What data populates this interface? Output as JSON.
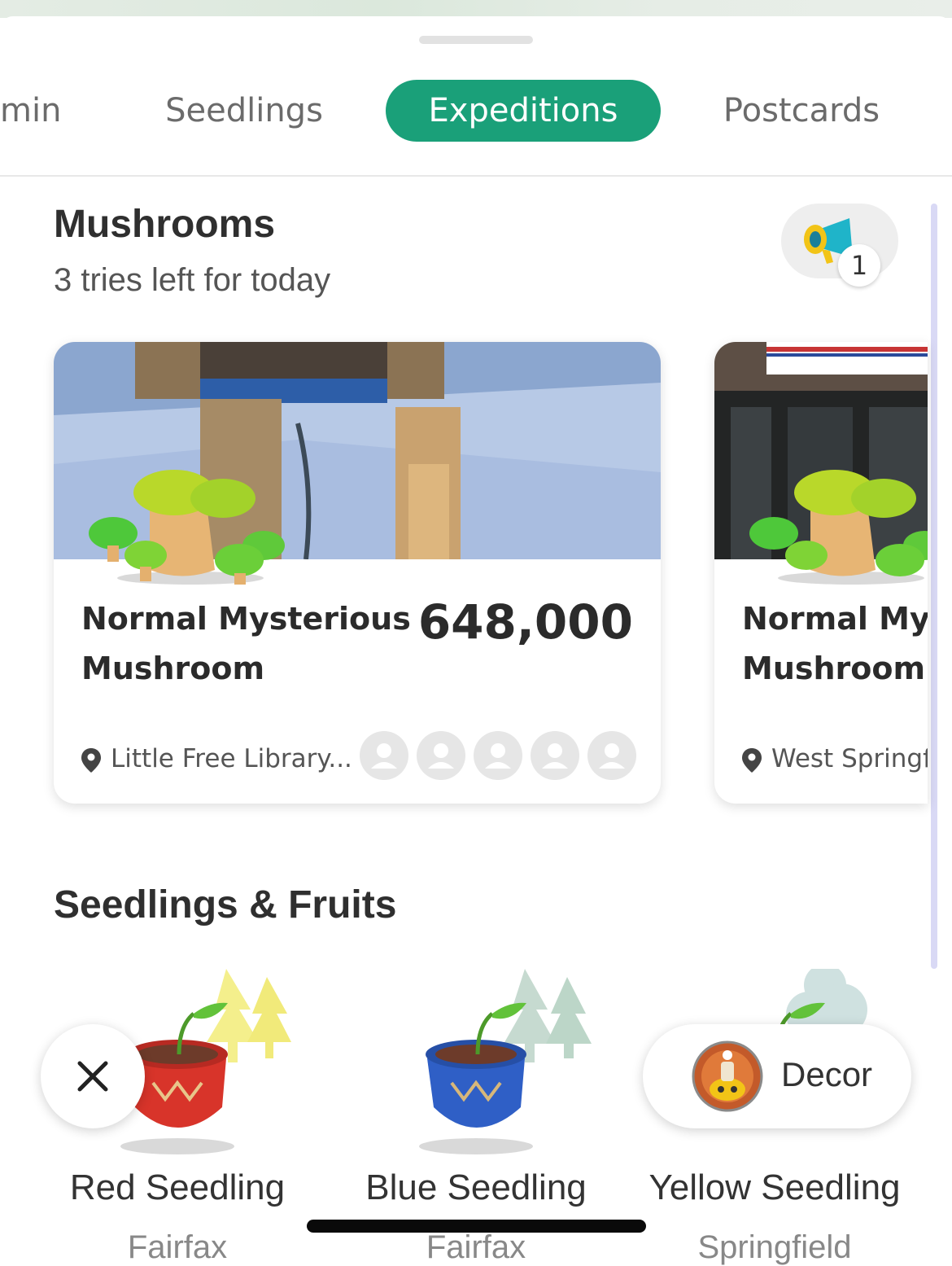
{
  "tabs": [
    {
      "label": "min",
      "active": false
    },
    {
      "label": "Seedlings",
      "active": false
    },
    {
      "label": "Expeditions",
      "active": true
    },
    {
      "label": "Postcards",
      "active": false
    }
  ],
  "colors": {
    "accent": "#1aa079"
  },
  "mushrooms": {
    "title": "Mushrooms",
    "subtitle": "3 tries left for today",
    "megaphone_count": "1",
    "megaphone_icon": "megaphone-icon",
    "cards": [
      {
        "name_line1": "Normal Mysterious",
        "name_line2": "Mushroom",
        "count": "648,000",
        "location": "Little Free Library...",
        "participants_empty": 5
      },
      {
        "name_line1": "Normal Mys",
        "name_line2": "Mushroom",
        "location": "West Springf"
      }
    ]
  },
  "seedlings": {
    "title": "Seedlings & Fruits",
    "items": [
      {
        "name": "Red Seedling",
        "location": "Fairfax",
        "pot_color": "#d8342a"
      },
      {
        "name": "Blue Seedling",
        "location": "Fairfax",
        "pot_color": "#2f5fc6"
      },
      {
        "name": "Yellow Seedling",
        "location": "Springfield",
        "pot_color": "#e8c21c"
      }
    ]
  },
  "buttons": {
    "close_icon": "close-icon",
    "decor_label": "Decor"
  }
}
